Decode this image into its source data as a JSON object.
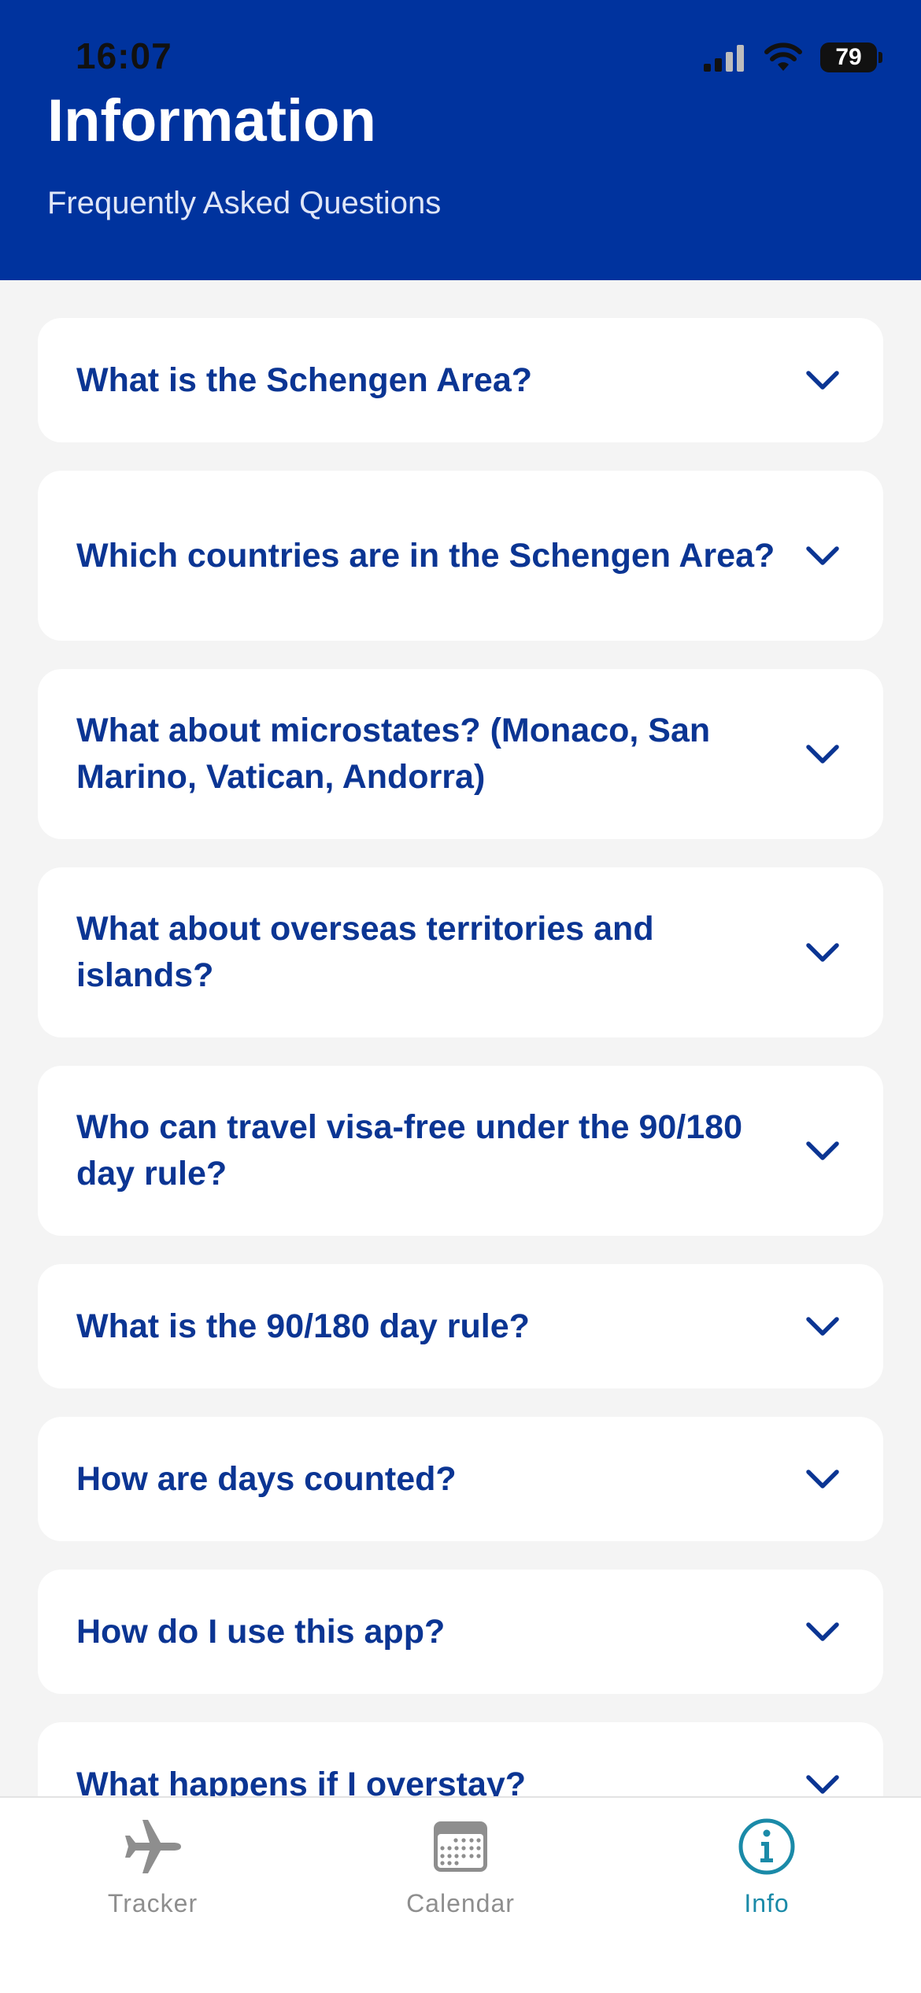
{
  "status_bar": {
    "time": "16:07",
    "battery": "79"
  },
  "header": {
    "title": "Information",
    "subtitle": "Frequently Asked Questions"
  },
  "faq": [
    {
      "question": "What is the Schengen Area?"
    },
    {
      "question": "Which countries are in the Schengen Area?"
    },
    {
      "question": "What about microstates? (Monaco, San Marino, Vatican, Andorra)"
    },
    {
      "question": "What about overseas territories and islands?"
    },
    {
      "question": "Who can travel visa-free under the 90/180 day rule?"
    },
    {
      "question": "What is the 90/180 day rule?"
    },
    {
      "question": "How are days counted?"
    },
    {
      "question": "How do I use this app?"
    },
    {
      "question": "What happens if I overstay?"
    }
  ],
  "tab_bar": {
    "tabs": [
      {
        "label": "Tracker",
        "icon": "airplane-icon"
      },
      {
        "label": "Calendar",
        "icon": "calendar-icon"
      },
      {
        "label": "Info",
        "icon": "info-icon",
        "active": true
      }
    ]
  },
  "colors": {
    "header_bg": "#00339e",
    "question_text": "#0b3593",
    "active_tab": "#1a8aa8",
    "inactive_tab": "#8e8e8e",
    "page_bg": "#f4f4f4"
  }
}
